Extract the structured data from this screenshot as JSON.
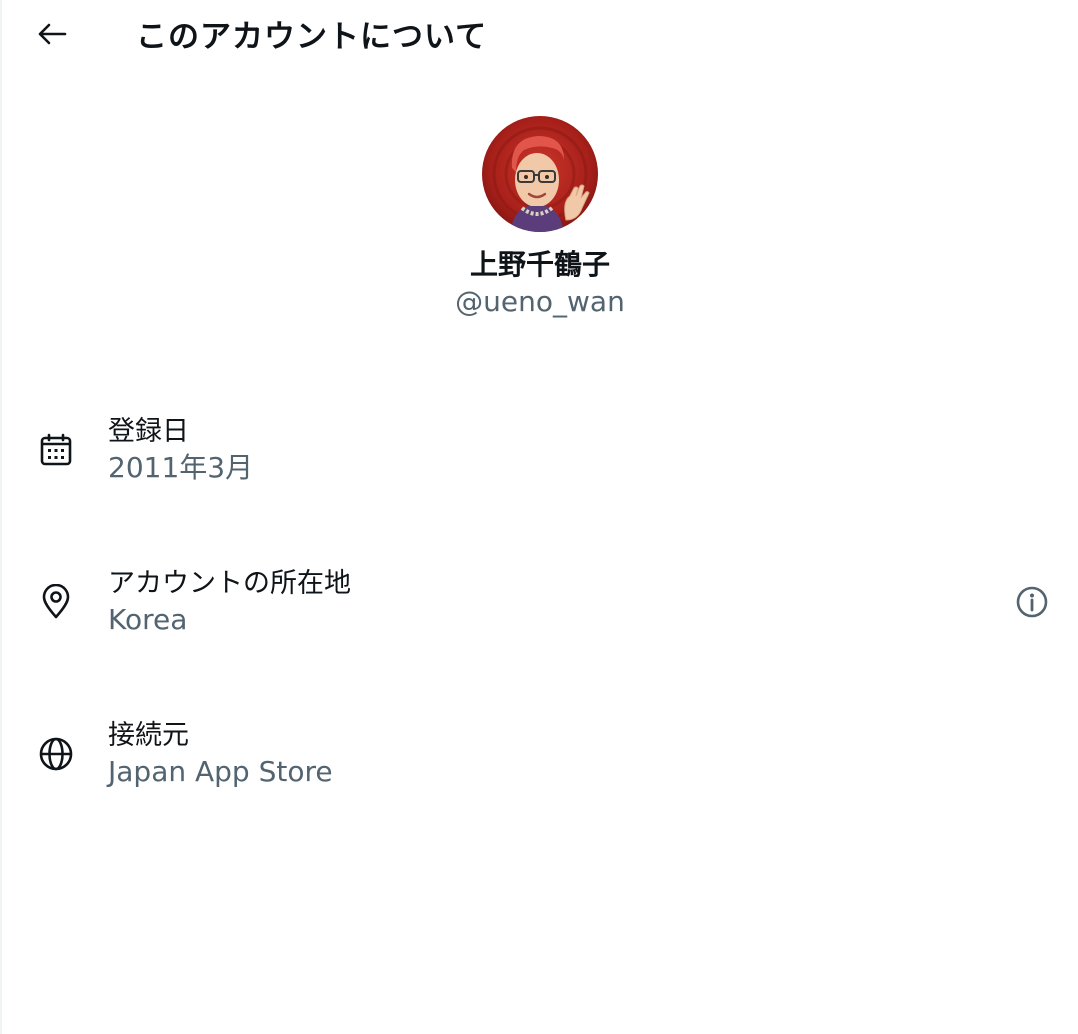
{
  "header": {
    "title": "このアカウントについて",
    "back_icon": "arrow-left-icon"
  },
  "profile": {
    "display_name": "上野千鶴子",
    "handle": "@ueno_wan",
    "avatar_bg": "#b8241c"
  },
  "details": [
    {
      "icon": "calendar-icon",
      "label": "登録日",
      "value": "2011年3月"
    },
    {
      "icon": "location-pin-icon",
      "label": "アカウントの所在地",
      "value": "Korea",
      "info_icon": "info-icon"
    },
    {
      "icon": "globe-icon",
      "label": "接続元",
      "value": "Japan App Store"
    }
  ],
  "colors": {
    "primary_text": "#0f1419",
    "secondary_text": "#536471"
  }
}
